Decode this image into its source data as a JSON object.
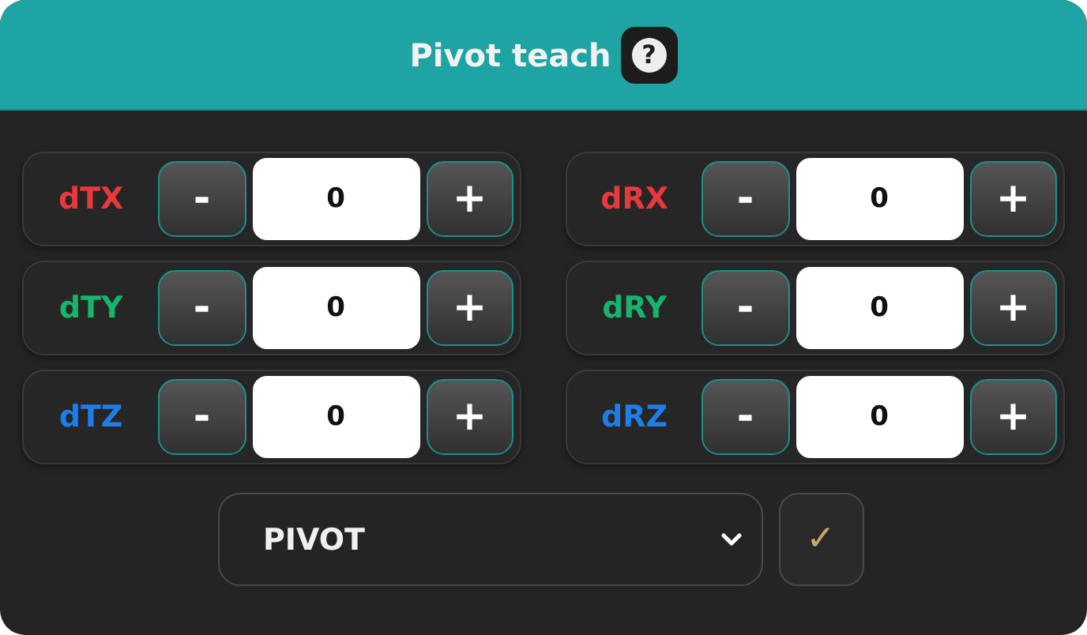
{
  "title": "Pivot teach",
  "help": "?",
  "controls": [
    {
      "label": "dTX",
      "color": "#e8383d",
      "minus": "-",
      "value": "0",
      "plus": "+"
    },
    {
      "label": "dRX",
      "color": "#e8383d",
      "minus": "-",
      "value": "0",
      "plus": "+"
    },
    {
      "label": "dTY",
      "color": "#17b46a",
      "minus": "-",
      "value": "0",
      "plus": "+"
    },
    {
      "label": "dRY",
      "color": "#17b46a",
      "minus": "-",
      "value": "0",
      "plus": "+"
    },
    {
      "label": "dTZ",
      "color": "#1f7de8",
      "minus": "-",
      "value": "0",
      "plus": "+"
    },
    {
      "label": "dRZ",
      "color": "#1f7de8",
      "minus": "-",
      "value": "0",
      "plus": "+"
    }
  ],
  "mode_select": {
    "value": "PIVOT"
  },
  "confirm": "✓"
}
